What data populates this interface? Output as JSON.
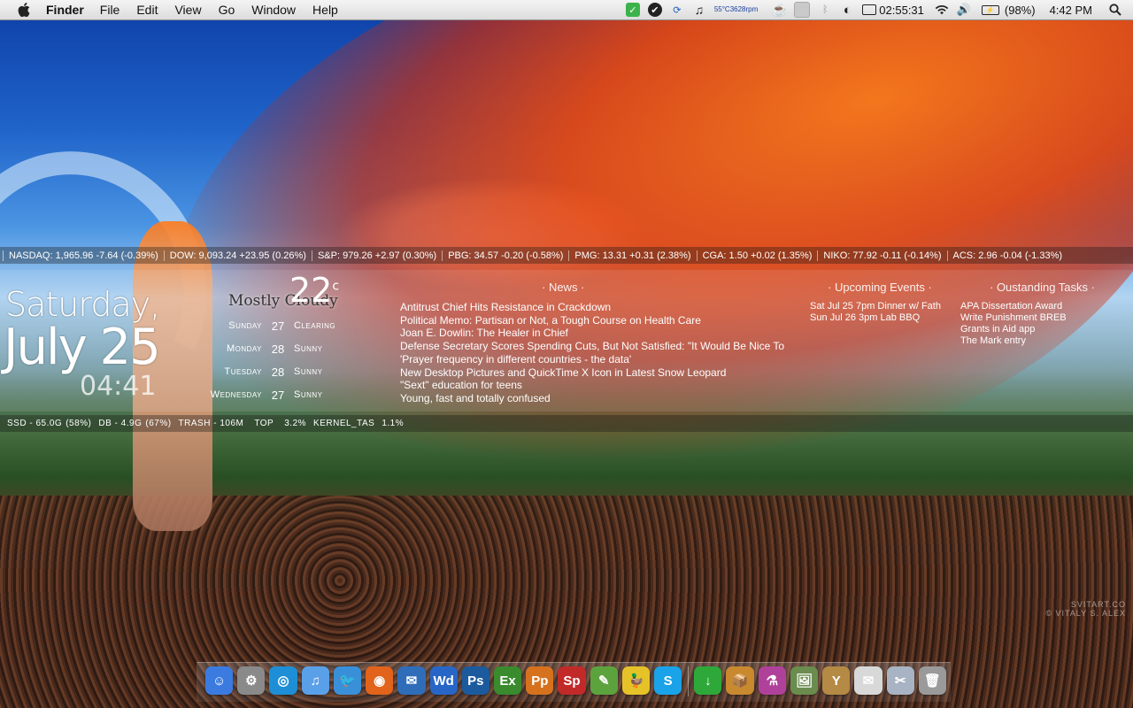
{
  "menubar": {
    "app_name": "Finder",
    "menus": [
      "File",
      "Edit",
      "View",
      "Go",
      "Window",
      "Help"
    ],
    "status": {
      "cpu_temp": "55°C",
      "fan_speed": "3628rpm",
      "uptime": "02:55:31",
      "battery": "(98%)",
      "clock": "4:42 PM"
    }
  },
  "ticker": [
    "NASDAQ: 1,965.96 -7.64 (-0.39%)",
    "DOW: 9,093.24 +23.95 (0.26%)",
    "S&P: 979.26 +2.97 (0.30%)",
    "PBG: 34.57 -0.20 (-0.58%)",
    "PMG: 13.31 +0.31 (2.38%)",
    "CGA: 1.50 +0.02 (1.35%)",
    "NIKO: 77.92 -0.11 (-0.14%)",
    "ACS: 2.96 -0.04 (-1.33%)"
  ],
  "date": {
    "day": "Saturday,",
    "month_day": "July 25",
    "time": "04:41"
  },
  "weather": {
    "condition": "Mostly Cloudy",
    "temp": "22",
    "unit": "c",
    "forecast": [
      {
        "day": "Sunday",
        "temp": "27",
        "desc": "Clearing"
      },
      {
        "day": "Monday",
        "temp": "28",
        "desc": "Sunny"
      },
      {
        "day": "Tuesday",
        "temp": "28",
        "desc": "Sunny"
      },
      {
        "day": "Wednesday",
        "temp": "27",
        "desc": "Sunny"
      }
    ]
  },
  "news": {
    "title": "· News ·",
    "items": [
      "Antitrust Chief Hits Resistance in Crackdown",
      "Political Memo: Partisan or Not, a Tough Course on Health Care",
      "Joan E. Dowlin: The Healer in Chief",
      "Defense Secretary Scores Spending Cuts, But Not Satisfied: \"It Would Be Nice To",
      "'Prayer frequency in different countries - the data'",
      "New Desktop Pictures and QuickTime X Icon in Latest Snow Leopard",
      "\"Sext\" education for teens",
      "Young, fast and totally confused"
    ]
  },
  "events": {
    "title": "· Upcoming Events ·",
    "items": [
      "Sat Jul 25  7pm Dinner w/ Fath",
      "Sun Jul 26  3pm Lab BBQ"
    ]
  },
  "tasks": {
    "title": "· Oustanding Tasks ·",
    "items": [
      "APA Dissertation Award",
      "Write Punishment BREB",
      "Grants in Aid app",
      "The Mark entry"
    ]
  },
  "stats": {
    "ssd": "SSD - 65.0G",
    "ssd_pct": "(58%)",
    "db": "DB - 4.9G",
    "db_pct": "(67%)",
    "trash": "TRASH - 106M",
    "top_label": "TOP",
    "top_pct": "3.2%",
    "top_proc": "KERNEL_TAS",
    "top_proc_pct": "1.1%"
  },
  "wallpaper_watermark": "SVITART.CO\n© VITALY S. ALEX",
  "dock": {
    "items": [
      {
        "name": "finder",
        "label": "☺",
        "color": "#3b7be0"
      },
      {
        "name": "system-prefs",
        "label": "⚙",
        "color": "#8a8a8a"
      },
      {
        "name": "network-utility",
        "label": "◎",
        "color": "#1e8fd6"
      },
      {
        "name": "itunes",
        "label": "♫",
        "color": "#5aa0e8"
      },
      {
        "name": "twitter-bird",
        "label": "🐦",
        "color": "#3a90d8"
      },
      {
        "name": "firefox",
        "label": "◉",
        "color": "#e2631b"
      },
      {
        "name": "thunderbird",
        "label": "✉",
        "color": "#2f6db8"
      },
      {
        "name": "word",
        "label": "Wd",
        "color": "#2766c7"
      },
      {
        "name": "photoshop",
        "label": "Ps",
        "color": "#1c5a9e"
      },
      {
        "name": "excel",
        "label": "Ex",
        "color": "#3a8a2e"
      },
      {
        "name": "powerpoint",
        "label": "Pp",
        "color": "#d6721d"
      },
      {
        "name": "spss",
        "label": "Sp",
        "color": "#c22a2a"
      },
      {
        "name": "evernote",
        "label": "✎",
        "color": "#5ca33d"
      },
      {
        "name": "adium",
        "label": "🦆",
        "color": "#e6c229"
      },
      {
        "name": "skype",
        "label": "S",
        "color": "#1aa3e8"
      },
      {
        "name": "downloads",
        "label": "↓",
        "color": "#2fa83a"
      },
      {
        "name": "packages",
        "label": "📦",
        "color": "#c8892f"
      },
      {
        "name": "potion",
        "label": "⚗",
        "color": "#b0419a"
      },
      {
        "name": "preview",
        "label": "🖼",
        "color": "#6b8c4f"
      },
      {
        "name": "yoga",
        "label": "Y",
        "color": "#b48a44"
      },
      {
        "name": "stamp",
        "label": "✉",
        "color": "#d8d8d8"
      },
      {
        "name": "clippings",
        "label": "✂",
        "color": "#a8b4c4"
      },
      {
        "name": "trash",
        "label": "🗑",
        "color": "#9a9a9a"
      }
    ]
  }
}
